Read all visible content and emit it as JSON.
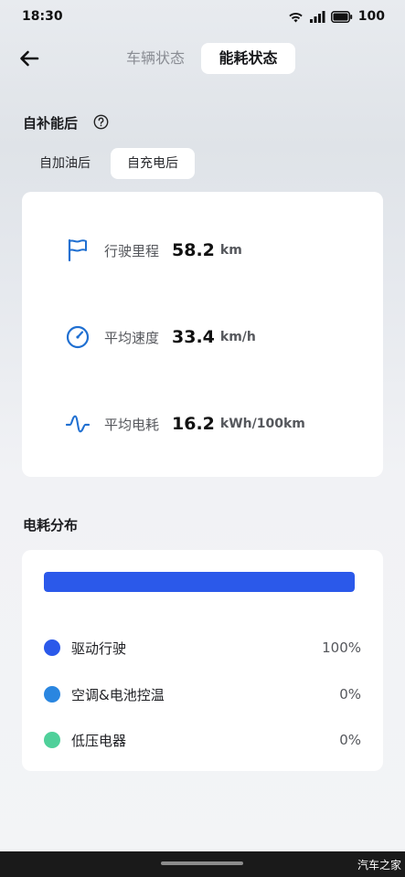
{
  "status_bar": {
    "time": "18:30",
    "battery": "100"
  },
  "header": {
    "tabs": [
      {
        "label": "车辆状态",
        "active": false
      },
      {
        "label": "能耗状态",
        "active": true
      }
    ]
  },
  "recharge_section": {
    "title": "自补能后",
    "subtabs": [
      {
        "label": "自加油后",
        "active": false
      },
      {
        "label": "自充电后",
        "active": true
      }
    ]
  },
  "metrics": [
    {
      "icon": "flag-icon",
      "label": "行驶里程",
      "value": "58.2",
      "unit": "km"
    },
    {
      "icon": "speedometer-icon",
      "label": "平均速度",
      "value": "33.4",
      "unit": "km/h"
    },
    {
      "icon": "wave-icon",
      "label": "平均电耗",
      "value": "16.2",
      "unit": "kWh/100km"
    }
  ],
  "distribution": {
    "title": "电耗分布",
    "bar_fill_percent": 100,
    "items": [
      {
        "label": "驱动行驶",
        "percent": "100%",
        "color": "#2b59ea"
      },
      {
        "label": "空调&电池控温",
        "percent": "0%",
        "color": "#2a86e0"
      },
      {
        "label": "低压电器",
        "percent": "0%",
        "color": "#4fd09a"
      }
    ]
  },
  "footer": {
    "watermark": "汽车之家"
  },
  "colors": {
    "accent": "#2b59ea",
    "icon_blue": "#1f6fd1"
  }
}
